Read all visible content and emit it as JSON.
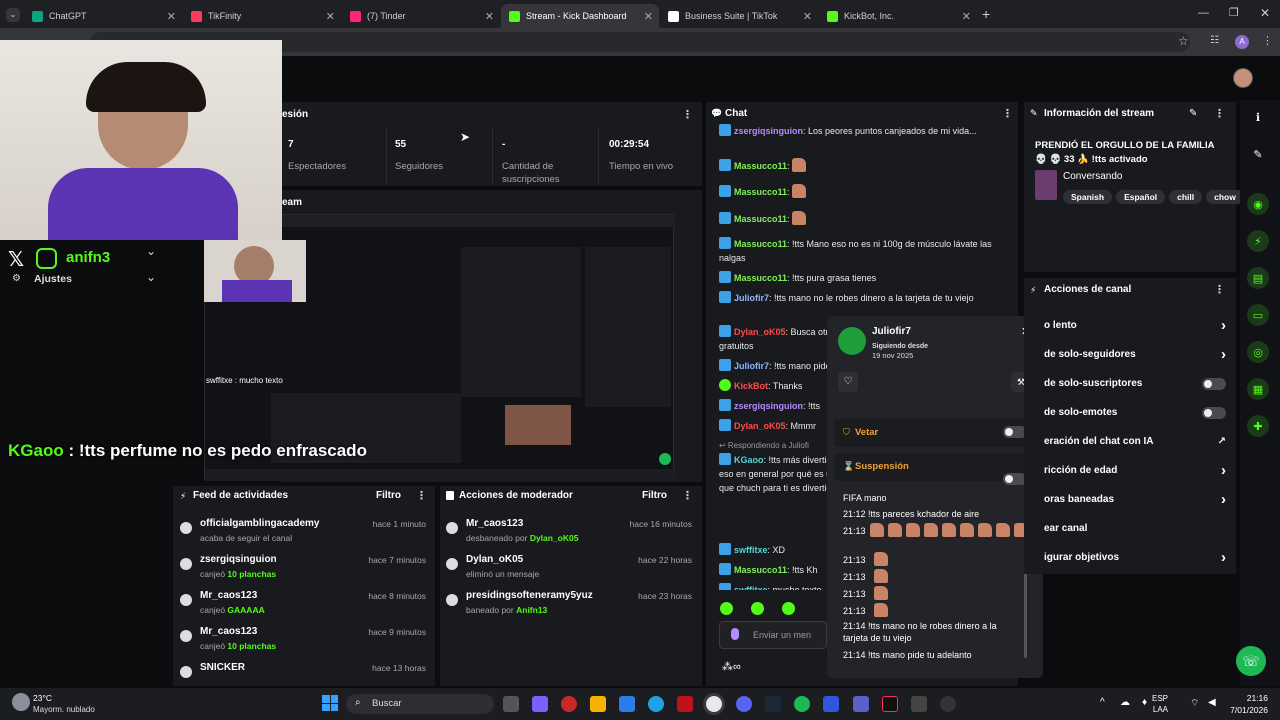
{
  "browser": {
    "tabs": [
      {
        "label": "ChatGPT",
        "color": "#10a37f"
      },
      {
        "label": "TikFinity",
        "color": "#ff3b5c"
      },
      {
        "label": "(7) Tinder",
        "color": "#fd267d"
      },
      {
        "label": "Stream - Kick Dashboard",
        "color": "#53fc18"
      },
      {
        "label": "Business Suite | TikTok",
        "color": "#ffffff"
      },
      {
        "label": "KickBot, Inc.",
        "color": "#53fc18"
      }
    ],
    "profile_initial": "A"
  },
  "stats": {
    "session_label": "esión",
    "viewers_value": "7",
    "viewers_label": "Espectadores",
    "followers_value": "55",
    "followers_label": "Seguidores",
    "subs_value": "-",
    "subs_label": "Cantidad de suscripciones",
    "live_value": "00:29:54",
    "live_label": "Tiempo en vivo",
    "stream_label": "eam"
  },
  "overlay": {
    "handle": "anifn3",
    "settings": "Ajustes",
    "preview_chat": "swffitxe : mucho texto",
    "big_chat_user": "KGaoo",
    "big_chat_text": " : !tts perfume no es pedo enfrascado"
  },
  "feed": {
    "title": "Feed de actividades",
    "filter": "Filtro",
    "items": [
      {
        "name": "officialgamblingacademy",
        "sub": "acaba de seguir el canal",
        "extra": "",
        "time": "hace 1 minuto"
      },
      {
        "name": "zsergiqsinguion",
        "sub": "canjeó ",
        "extra": "10 planchas",
        "time": "hace 7 minutos"
      },
      {
        "name": "Mr_caos123",
        "sub": "canjeó ",
        "extra": "GAAAAA",
        "time": "hace 8 minutos"
      },
      {
        "name": "Mr_caos123",
        "sub": "canjeó ",
        "extra": "10 planchas",
        "time": "hace 9 minutos"
      },
      {
        "name": "SNICKER",
        "sub": "",
        "extra": "",
        "time": "hace 13 horas"
      }
    ]
  },
  "modactions": {
    "title": "Acciones de moderador",
    "filter": "Filtro",
    "items": [
      {
        "name": "Mr_caos123",
        "sub": "desbaneado por ",
        "extra": "Dylan_oK05",
        "time": "hace 16 minutos"
      },
      {
        "name": "Dylan_oK05",
        "sub": "eliminó un mensaje",
        "extra": "",
        "time": "hace 22 horas"
      },
      {
        "name": "presidingsofteneramy5yuz",
        "sub": "baneado por ",
        "extra": "Anifn13",
        "time": "hace 23 horas"
      }
    ]
  },
  "chat": {
    "title": "Chat",
    "input_placeholder": "Enviar un men",
    "lines": [
      {
        "user": "zsergiqsinguion",
        "cls": "u-purple",
        "text": ": Los peores puntos canjeados de mi vida..."
      },
      {
        "user": "Massucco11",
        "cls": "u-green",
        "text": ": "
      },
      {
        "user": "Massucco11",
        "cls": "u-green",
        "text": ": "
      },
      {
        "user": "Massucco11",
        "cls": "u-green",
        "text": ": "
      },
      {
        "user": "Massucco11",
        "cls": "u-green",
        "text": ": !tts Mano eso no es ni 100g de músculo lávate las nalgas"
      },
      {
        "user": "Massucco11",
        "cls": "u-green",
        "text": ": !tts pura grasa tienes"
      },
      {
        "user": "Juliofir7",
        "cls": "u-blue",
        "text": ": !tts mano no le robes dinero a la tarjeta de tu viejo"
      },
      {
        "user": "Dylan_oK05",
        "cls": "u-red",
        "text": ": Busca otros programas primero,capas haigan otros gratuitos"
      },
      {
        "user": "Juliofir7",
        "cls": "u-blue",
        "text": ": !tts mano pide"
      },
      {
        "user": "KickBot",
        "cls": "u-red",
        "text": ": Thanks"
      },
      {
        "user": "zsergiqsinguion",
        "cls": "u-purple",
        "text": ": !tts"
      },
      {
        "user": "Dylan_oK05",
        "cls": "u-red",
        "text": ": Mmmr"
      },
      {
        "user": "",
        "cls": "",
        "text": "↩ Respondiendo a Juliofi"
      },
      {
        "user": "KGaoo",
        "cls": "u-teal",
        "text": ": !tts más divertid solitario es aburrido gar tras partido solo eso en general por qué es un ju puedes desde hacer ha pero en FIFA que chuch para ti es divertido?"
      },
      {
        "user": "swffitxe",
        "cls": "u-teal",
        "text": ": XD"
      },
      {
        "user": "Massucco11",
        "cls": "u-green",
        "text": ": !tts Kh"
      },
      {
        "user": "swffitxe",
        "cls": "u-teal",
        "text": ": mucho texto"
      },
      {
        "user": "KGaoo",
        "cls": "u-teal",
        "text": ": !tts perfume no"
      }
    ]
  },
  "popup": {
    "username": "Juliofir7",
    "following_label": "Siguiendo desde",
    "following_date": "19 nov 2025",
    "veto": "Vetar",
    "suspension": "Suspensión",
    "msgs": [
      "FIFA mano",
      "21:12 !tts pareces kchador de aire",
      "21:13",
      "21:13",
      "21:13",
      "21:13",
      "21:13",
      "21:14 !tts mano no le robes dinero a la tarjeta de tu viejo",
      "21:14 !tts mano pide tu adelanto"
    ]
  },
  "streaminfo": {
    "title": "Información del stream",
    "stream_title": "PRENDIÓ EL ORGULLO DE LA FAMILIA 💀 💀 33 🍌 !tts activado",
    "category": "Conversando",
    "tags": [
      "Spanish",
      "Español",
      "chill",
      "chow"
    ]
  },
  "channel_actions": {
    "title": "Acciones de canal",
    "items": [
      {
        "label": "o lento",
        "ctl": "chev"
      },
      {
        "label": "de solo-seguidores",
        "ctl": "chev"
      },
      {
        "label": "de solo-suscriptores",
        "ctl": "toggle"
      },
      {
        "label": "de solo-emotes",
        "ctl": "toggle"
      },
      {
        "label": "eración del chat con IA",
        "ctl": "ext"
      },
      {
        "label": "ricción de edad",
        "ctl": "chev"
      },
      {
        "label": "oras baneadas",
        "ctl": "chev"
      },
      {
        "label": "ear canal",
        "ctl": ""
      },
      {
        "label": "igurar objetivos",
        "ctl": "chev"
      }
    ]
  },
  "taskbar": {
    "weather_temp": "23°C",
    "weather_desc": "Mayorm. nublado",
    "search": "Buscar",
    "lang_top": "ESP",
    "lang_bottom": "LAA",
    "time": "21:16",
    "date": "7/01/2026"
  },
  "colors": {
    "kick_green": "#53fc18",
    "panel": "#191a1d",
    "bg": "#0b0c0e"
  }
}
